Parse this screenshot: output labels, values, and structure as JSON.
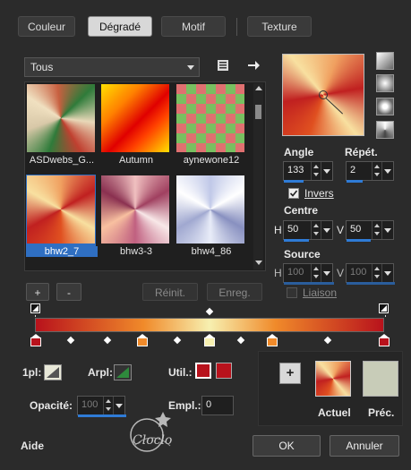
{
  "tabs": [
    {
      "label": "Couleur"
    },
    {
      "label": "Dégradé"
    },
    {
      "label": "Motif"
    },
    {
      "label": "Texture"
    }
  ],
  "library": {
    "filter": "Tous",
    "thumbnails": [
      {
        "name": "ASDwebs_G..."
      },
      {
        "name": "Autumn"
      },
      {
        "name": "aynewone12"
      },
      {
        "name": "bhw2_7"
      },
      {
        "name": "bhw3-3"
      },
      {
        "name": "bhw4_86"
      }
    ],
    "add_label": "+",
    "remove_label": "-",
    "reset_label": "Réinit.",
    "save_label": "Enreg."
  },
  "controls": {
    "angle_label": "Angle",
    "angle_value": "133",
    "repeat_label": "Répét.",
    "repeat_value": "2",
    "invert_label": "Invers",
    "center_label": "Centre",
    "h_label": "H",
    "v_label": "V",
    "center_h": "50",
    "center_v": "50",
    "source_label": "Source",
    "source_h": "100",
    "source_v": "100",
    "link_label": "Liaison"
  },
  "stops": {
    "one_pl_label": "1pl:",
    "arpl_label": "Arpl:",
    "util_label": "Util.:",
    "opacity_label": "Opacité:",
    "opacity_value": "100",
    "empl_label": "Empl.:",
    "empl_value": "0",
    "util_color": "#b8121c"
  },
  "preview": {
    "plus_label": "+",
    "current_label": "Actuel",
    "previous_label": "Préc."
  },
  "footer": {
    "help_label": "Aide",
    "ok_label": "OK",
    "cancel_label": "Annuler",
    "watermark": "Cloclo"
  },
  "colors": {
    "selection": "#2f6fc2",
    "accent_bar": "#2f7bd6",
    "red_stop": "#b8121c",
    "orange_stop": "#f08a2a",
    "cream_stop": "#f7f0b0"
  }
}
